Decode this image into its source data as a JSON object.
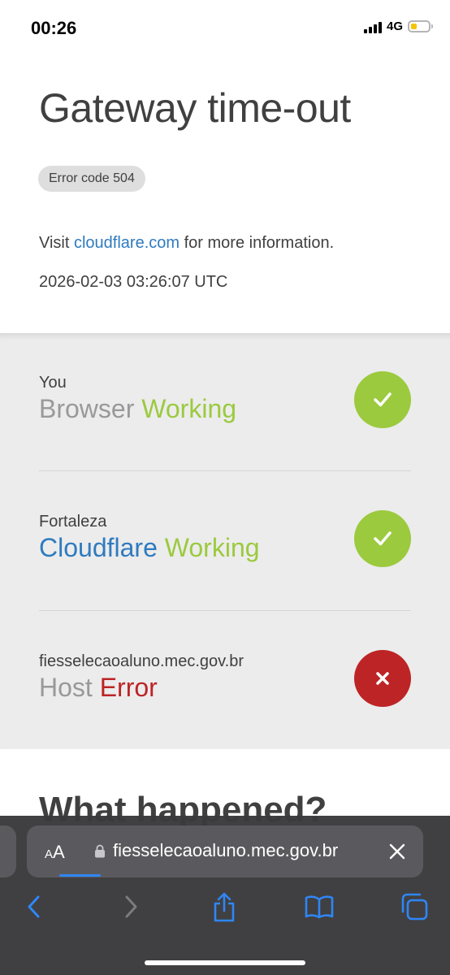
{
  "status_bar": {
    "time": "00:26",
    "network": "4G",
    "battery_color": "#f5c400"
  },
  "page": {
    "title": "Gateway time-out",
    "error_badge": "Error code 504",
    "info_prefix": "Visit",
    "info_link": "cloudflare.com",
    "info_suffix": "for more information.",
    "timestamp": "2026-02-03 03:26:07 UTC"
  },
  "status_rows": [
    {
      "location": "You",
      "name": "Browser",
      "state": "Working",
      "ok": true
    },
    {
      "location": "Fortaleza",
      "name": "Cloudflare",
      "state": "Working",
      "ok": true
    },
    {
      "location": "fiesselecaoaluno.mec.gov.br",
      "name": "Host",
      "state": "Error",
      "ok": false
    }
  ],
  "section": {
    "what_happened": "What happened?"
  },
  "safari": {
    "aa_label": "AA",
    "url": "fiesselecaoaluno.mec.gov.br",
    "icons": [
      "back-icon",
      "forward-icon",
      "share-icon",
      "bookmarks-icon",
      "tabs-icon"
    ],
    "accent": "#2f86f6"
  },
  "colors": {
    "working": "#9bca3e",
    "error": "#bd2426",
    "link": "#2f7bbf"
  }
}
